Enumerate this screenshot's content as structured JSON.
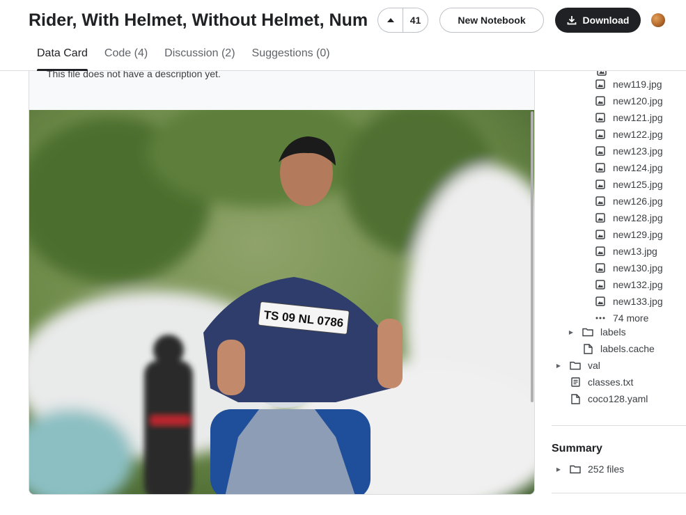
{
  "dataset": {
    "title": "Rider, With Helmet, Without Helmet, Number Plate",
    "vote_count": "41"
  },
  "actions": {
    "new_notebook": "New Notebook",
    "download": "Download"
  },
  "tabs": [
    {
      "label": "Data Card"
    },
    {
      "label": "Code (4)"
    },
    {
      "label": "Discussion (2)"
    },
    {
      "label": "Suggestions (0)"
    }
  ],
  "card": {
    "description": "This file does not have a description yet."
  },
  "photo": {
    "plate_text": "TS 09 NL 0786"
  },
  "file_tree": {
    "images": [
      "new119.jpg",
      "new120.jpg",
      "new121.jpg",
      "new122.jpg",
      "new123.jpg",
      "new124.jpg",
      "new125.jpg",
      "new126.jpg",
      "new128.jpg",
      "new129.jpg",
      "new13.jpg",
      "new130.jpg",
      "new132.jpg",
      "new133.jpg"
    ],
    "more": "74 more",
    "labels_folder": "labels",
    "labels_cache": "labels.cache",
    "val_folder": "val",
    "classes": "classes.txt",
    "yaml": "coco128.yaml"
  },
  "summary": {
    "title": "Summary",
    "files": "252 files"
  },
  "colors": {
    "accent_dark": "#202124",
    "border": "#dadce0"
  }
}
